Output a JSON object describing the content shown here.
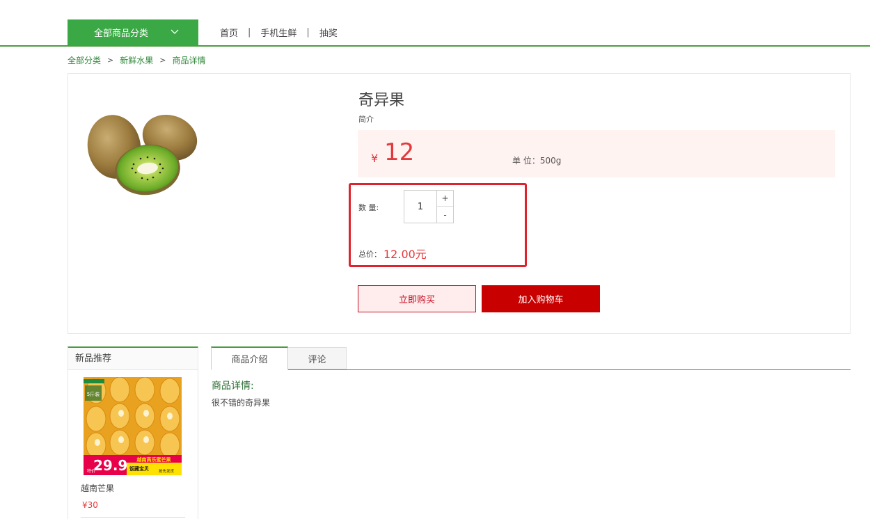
{
  "nav": {
    "category_button": "全部商品分类",
    "links": [
      "首页",
      "手机生鲜",
      "抽奖"
    ],
    "separator": "|"
  },
  "breadcrumb": {
    "items": [
      "全部分类",
      "新鲜水果",
      "商品详情"
    ],
    "arrow": ">"
  },
  "product": {
    "name": "奇异果",
    "intro": "简介",
    "currency": "¥",
    "price": "12",
    "unit": "单 位：500g",
    "quantity_label": "数 量:",
    "quantity": "1",
    "plus": "+",
    "minus": "-",
    "total_label": "总价：",
    "total_value": "12.00元",
    "buy_now": "立即购买",
    "add_to_cart": "加入购物车"
  },
  "sidebar": {
    "title": "新品推荐",
    "item": {
      "name": "越南芒果",
      "price": "¥30",
      "image_texts": {
        "big_price": "29.9",
        "small_left": "特价",
        "headline": "越南高乐蜜芒果",
        "sub1": "饭藏宝贝",
        "sub2": "抢先发货",
        "badge": "5斤装"
      }
    }
  },
  "tabs": {
    "items": [
      "商品介绍",
      "评论"
    ],
    "active_index": 0
  },
  "detail": {
    "title": "商品详情:",
    "text": "很不错的奇异果"
  },
  "colors": {
    "green": "#3aa845",
    "red": "#e4393c",
    "cart_red": "#c80000",
    "highlight": "#e0222c"
  }
}
